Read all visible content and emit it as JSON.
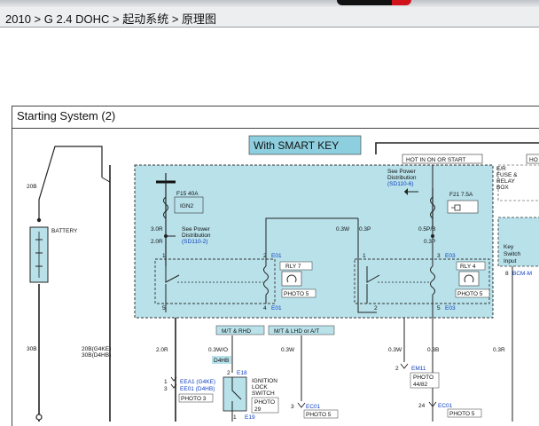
{
  "breadcrumb": {
    "text": "2010 > G 2.4 DOHC > 起动系统 > 原理图"
  },
  "diagram": {
    "title": "Starting System (2)",
    "smart_key_label": "With SMART KEY",
    "hot_in_on_or_start": "HOT IN ON OR START",
    "hot_right": "HO",
    "er_fuse_relay_box": [
      "E/R",
      "FUSE &",
      "RELAY",
      "BOX"
    ],
    "fuse_left": {
      "id": "F15 40A",
      "name": "IGN2"
    },
    "fuse_right": {
      "id": "F21 7.5A"
    },
    "see_power_left": [
      "See Power",
      "Distribution",
      "(SD110-2)"
    ],
    "see_power_right": [
      "See Power",
      "Distribution",
      "(SD110-6)"
    ],
    "battery_label": "BATTERY",
    "relay_left": {
      "name": "RLY 7",
      "photo": "PHOTO 5",
      "conn": "E01"
    },
    "relay_right": {
      "name": "RLY 4",
      "photo": "PHOTO 5",
      "conn": "E03"
    },
    "key_switch_input": [
      "Key",
      "Switch",
      "Input"
    ],
    "bcm_label": "BCM-M",
    "pin_8": "8",
    "wires": {
      "w20b": "20B",
      "w30b": "30B",
      "w30r": "3.0R",
      "w20r_a": "2.0R",
      "w03w": "0.3W",
      "w03p": "0.3P",
      "w05pb": "0.5P/B",
      "w03p_b": "0.3P",
      "w20r_b": "2.0R",
      "w03wo": "0.3W/O",
      "w03w_b": "0.3W",
      "w03w_c": "0.3W",
      "w03b": "0.3B",
      "w03r": "0.3R",
      "w20b_g4ke": "20B(G4KE)",
      "w30b_d4hb": "30B(D4HB)"
    },
    "pins": {
      "p1a": "1",
      "p2a": "2",
      "p1b": "1",
      "p3b": "3",
      "p5a": "5",
      "p4a": "4",
      "p2b": "2",
      "p5b": "5"
    },
    "mt_rhd": "M/T & RHD",
    "mt_lhd": "M/T & LHD or A/T",
    "d4hb": "D4HB",
    "ignition": {
      "conn": "E18",
      "pin": "2",
      "name": [
        "IGNITION",
        "LOCK",
        "SWITCH"
      ],
      "photo": "PHOTO",
      "photo_no": "29",
      "bottom": "E19",
      "bottom_pin": "1"
    },
    "eea1": {
      "pins": [
        "1",
        "3"
      ],
      "lines": [
        "EEA1 (G4KE)",
        "EE01 (D4HB)"
      ],
      "photo": "PHOTO 3"
    },
    "ec01_a": {
      "pin": "3",
      "conn": "EC01",
      "photo": "PHOTO 5"
    },
    "em11": {
      "pin": "2",
      "conn": "EM11",
      "photo": "PHOTO",
      "photo_no": "44/82"
    },
    "ec01_b": {
      "pin": "24",
      "conn": "EC01",
      "photo": "PHOTO 5"
    }
  }
}
